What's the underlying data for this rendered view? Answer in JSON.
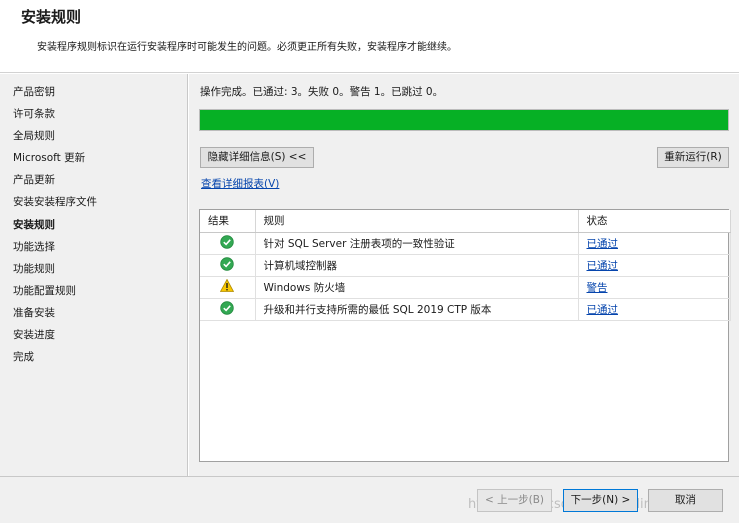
{
  "header": {
    "title": "安装规则",
    "description": "安装程序规则标识在运行安装程序时可能发生的问题。必须更正所有失败，安装程序才能继续。"
  },
  "sidebar": {
    "items": [
      {
        "label": "产品密钥",
        "active": false
      },
      {
        "label": "许可条款",
        "active": false
      },
      {
        "label": "全局规则",
        "active": false
      },
      {
        "label": "Microsoft 更新",
        "active": false
      },
      {
        "label": "产品更新",
        "active": false
      },
      {
        "label": "安装安装程序文件",
        "active": false
      },
      {
        "label": "安装规则",
        "active": true
      },
      {
        "label": "功能选择",
        "active": false
      },
      {
        "label": "功能规则",
        "active": false
      },
      {
        "label": "功能配置规则",
        "active": false
      },
      {
        "label": "准备安装",
        "active": false
      },
      {
        "label": "安装进度",
        "active": false
      },
      {
        "label": "完成",
        "active": false
      }
    ]
  },
  "main": {
    "status_text": "操作完成。已通过: 3。失败 0。警告 1。已跳过 0。",
    "progress_fraction": 1.0,
    "progress_color": "#06b025",
    "hide_details_label": "隐藏详细信息(S) <<",
    "rerun_label": "重新运行(R)",
    "view_report_label": "查看详细报表(V)",
    "grid": {
      "headers": [
        "结果",
        "规则",
        "状态"
      ],
      "rows": [
        {
          "icon": "success-icon",
          "rule": "针对 SQL Server 注册表项的一致性验证",
          "status": "已通过"
        },
        {
          "icon": "success-icon",
          "rule": "计算机域控制器",
          "status": "已通过"
        },
        {
          "icon": "warning-icon",
          "rule": "Windows 防火墙",
          "status": "警告"
        },
        {
          "icon": "success-icon",
          "rule": "升级和并行支持所需的最低 SQL 2019 CTP 版本",
          "status": "已通过"
        }
      ]
    }
  },
  "footer": {
    "back_label": "< 上一步(B)",
    "next_label": "下一步(N) >",
    "cancel_label": "取消",
    "watermark": "https://blog.csdn.net/puddingpudding"
  },
  "colors": {
    "success": "#33a853",
    "warning": "#f7c600",
    "link": "#0645ad"
  }
}
